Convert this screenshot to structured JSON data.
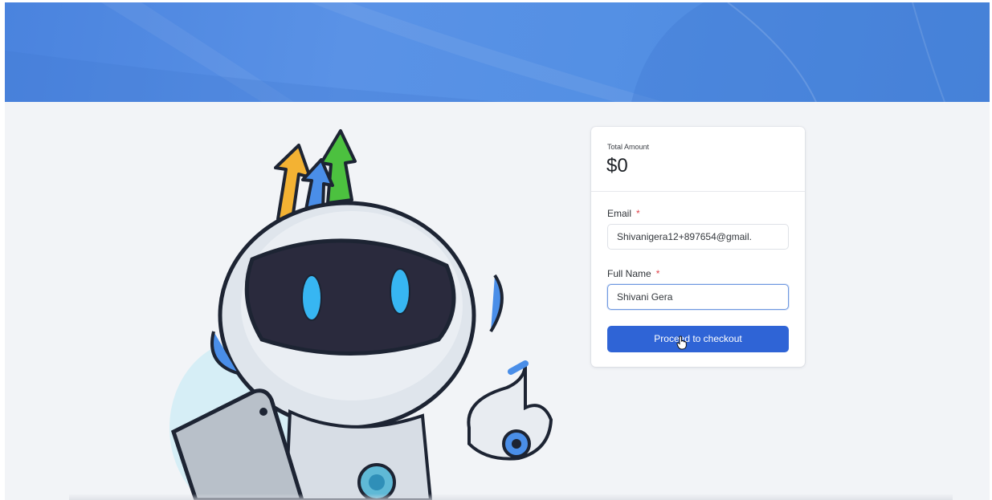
{
  "checkout": {
    "total_label": "Total Amount",
    "total_value": "$0",
    "email_label": "Email",
    "email_value": "Shivanigera12+897654@gmail.",
    "name_label": "Full Name",
    "name_value": "Shivani Gera",
    "required_mark": "*",
    "button_label": "Proceed to checkout"
  },
  "colors": {
    "banner": "#4f8ae1",
    "button": "#2f64d6",
    "page_bg": "#f2f4f7",
    "required": "#e0424a"
  },
  "icons": [
    "robot-mascot-illustration",
    "arrows-up-icon",
    "hand-pointer-cursor-icon"
  ]
}
